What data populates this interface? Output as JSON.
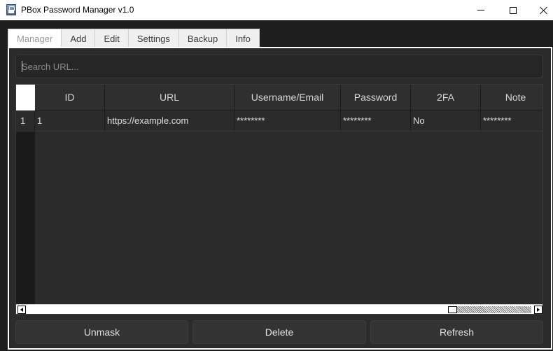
{
  "window": {
    "title": "PBox Password Manager v1.0"
  },
  "tabs": [
    {
      "label": "Manager",
      "active": true
    },
    {
      "label": "Add",
      "active": false
    },
    {
      "label": "Edit",
      "active": false
    },
    {
      "label": "Settings",
      "active": false
    },
    {
      "label": "Backup",
      "active": false
    },
    {
      "label": "Info",
      "active": false
    }
  ],
  "search": {
    "placeholder": "Search URL...",
    "value": ""
  },
  "table": {
    "columns": [
      "ID",
      "URL",
      "Username/Email",
      "Password",
      "2FA",
      "Note"
    ],
    "rows": [
      {
        "row_number": "1",
        "cells": [
          "1",
          "https://example.com",
          "********",
          "********",
          "No",
          "********"
        ]
      }
    ],
    "scrollbar": {
      "position": 0.85,
      "visible_fraction": 0.15
    }
  },
  "buttons": {
    "unmask": "Unmask",
    "delete": "Delete",
    "refresh": "Refresh"
  },
  "icons": {
    "app": "lock-icon",
    "minimize": "minimize-icon",
    "maximize": "maximize-icon",
    "close": "close-icon"
  },
  "colors": {
    "background": "#1e1e1e",
    "panel": "#2b2b2b",
    "header": "#2f2f2f",
    "text": "#e0e0e0"
  }
}
